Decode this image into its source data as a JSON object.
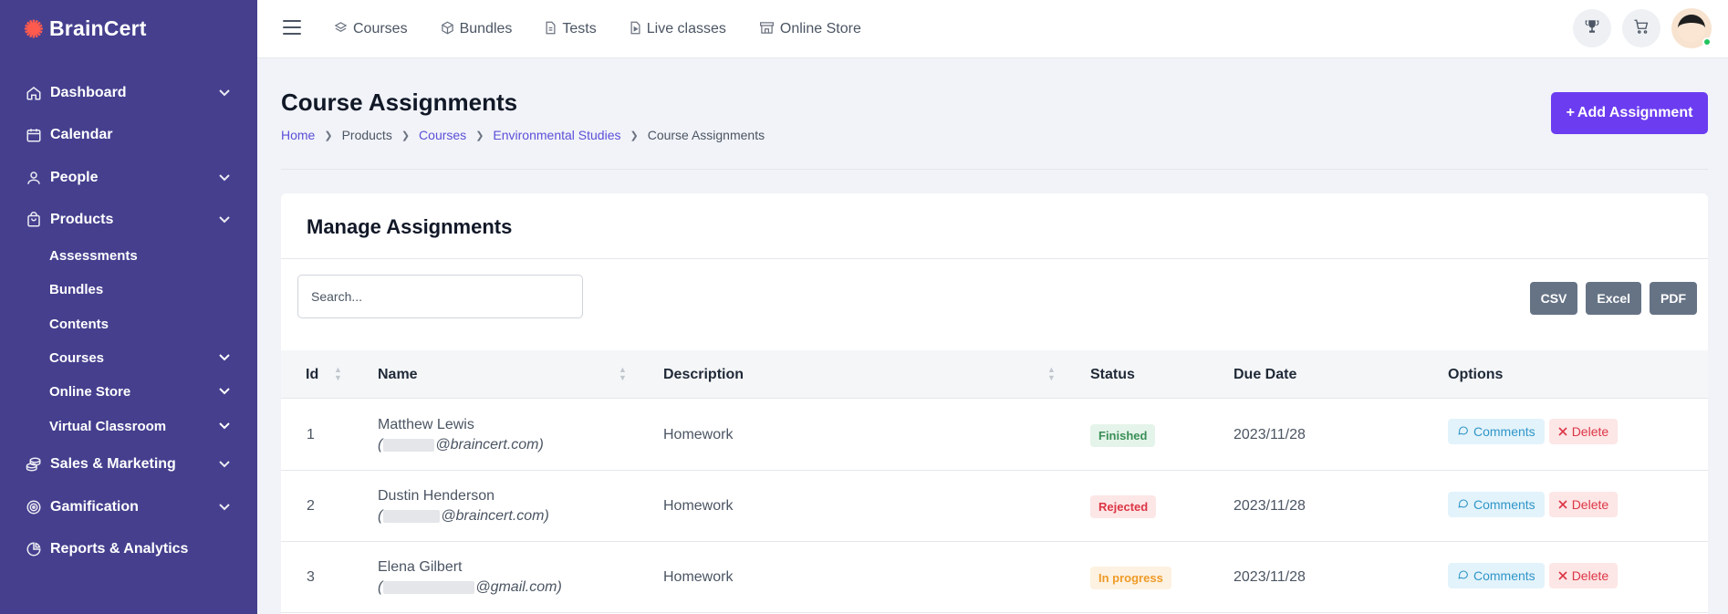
{
  "brand": {
    "name": "BrainCert"
  },
  "sidebar": {
    "items": [
      {
        "label": "Dashboard",
        "icon": "home-icon",
        "chevron": "⌄"
      },
      {
        "label": "Calendar",
        "icon": "calendar-icon",
        "chevron": ""
      },
      {
        "label": "People",
        "icon": "person-icon",
        "chevron": "⌄"
      },
      {
        "label": "Products",
        "icon": "bag-icon",
        "chevron": "⌄"
      }
    ],
    "subitems": [
      {
        "label": "Assessments",
        "chevron": ""
      },
      {
        "label": "Bundles",
        "chevron": ""
      },
      {
        "label": "Contents",
        "chevron": ""
      },
      {
        "label": "Courses",
        "chevron": "⌄"
      },
      {
        "label": "Online Store",
        "chevron": "⌄"
      },
      {
        "label": "Virtual Classroom",
        "chevron": "⌄"
      }
    ],
    "bottom_items": [
      {
        "label": "Sales & Marketing",
        "icon": "coins-icon",
        "chevron": "⌄"
      },
      {
        "label": "Gamification",
        "icon": "target-icon",
        "chevron": "⌄"
      },
      {
        "label": "Reports & Analytics",
        "icon": "pie-chart-icon",
        "chevron": ""
      }
    ]
  },
  "topnav": {
    "items": [
      {
        "label": "Courses",
        "icon": "layers-icon"
      },
      {
        "label": "Bundles",
        "icon": "box-icon"
      },
      {
        "label": "Tests",
        "icon": "file-icon"
      },
      {
        "label": "Live classes",
        "icon": "file-play-icon"
      },
      {
        "label": "Online Store",
        "icon": "store-icon"
      }
    ]
  },
  "page": {
    "title": "Course Assignments",
    "breadcrumb": [
      "Home",
      "Products",
      "Courses",
      "Environmental Studies",
      "Course Assignments"
    ],
    "add_button": "Add Assignment"
  },
  "card": {
    "title": "Manage Assignments",
    "search_placeholder": "Search...",
    "exports": [
      "CSV",
      "Excel",
      "PDF"
    ]
  },
  "table": {
    "columns": [
      "Id",
      "Name",
      "Description",
      "Status",
      "Due Date",
      "Options"
    ],
    "rows": [
      {
        "id": "1",
        "name": "Matthew Lewis",
        "email_prefix": "(",
        "email_suffix": "@braincert.com)",
        "description": "Homework",
        "status": "Finished",
        "due": "2023/11/28"
      },
      {
        "id": "2",
        "name": "Dustin Henderson",
        "email_prefix": "(",
        "email_suffix": "@braincert.com)",
        "description": "Homework",
        "status": "Rejected",
        "due": "2023/11/28"
      },
      {
        "id": "3",
        "name": "Elena Gilbert",
        "email_prefix": "(",
        "email_suffix": "@gmail.com)",
        "description": "Homework",
        "status": "In progress",
        "due": "2023/11/28"
      }
    ],
    "comments_label": "Comments",
    "delete_label": "Delete"
  },
  "colors": {
    "sidebar": "#453f8e",
    "accent": "#6c3cf0",
    "finished": "#3a8f57",
    "rejected": "#dc3545",
    "in_progress": "#ef9b27"
  }
}
